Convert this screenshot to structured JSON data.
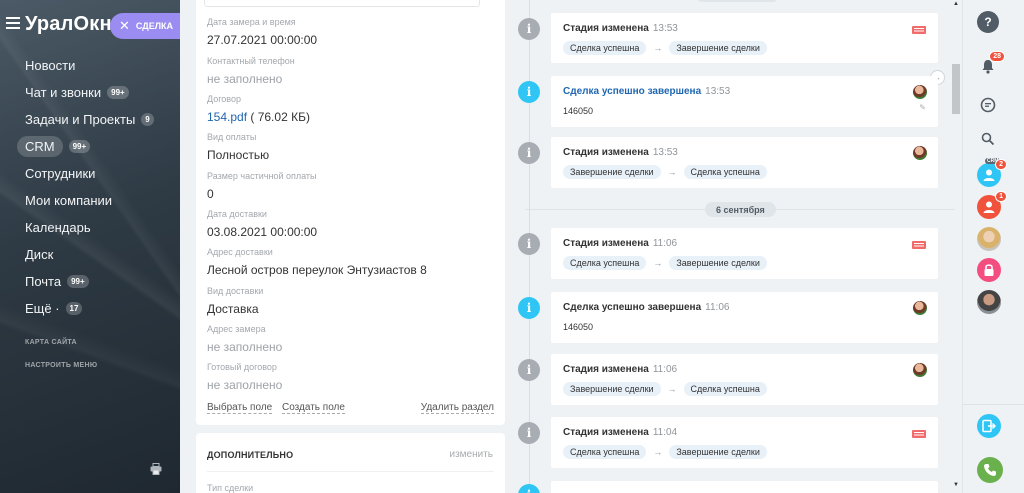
{
  "left_nav": {
    "brand": "УралОкно",
    "deal_pill": "СДЕЛКА",
    "items": [
      {
        "label": "Новости",
        "badge": ""
      },
      {
        "label": "Чат и звонки",
        "badge": "99+"
      },
      {
        "label": "Задачи и Проекты",
        "badge": "9"
      },
      {
        "label": "CRM",
        "badge": "99+"
      },
      {
        "label": "Сотрудники",
        "badge": ""
      },
      {
        "label": "Мои компании",
        "badge": ""
      },
      {
        "label": "Календарь",
        "badge": ""
      },
      {
        "label": "Диск",
        "badge": ""
      },
      {
        "label": "Почта",
        "badge": "99+"
      },
      {
        "label": "Ещё ·",
        "badge": "17"
      }
    ],
    "sitemap": "КАРТА САЙТА",
    "settings": "НАСТРОИТЬ МЕНЮ"
  },
  "details": {
    "fields": [
      {
        "label": "Дата замера и время",
        "value": "27.07.2021 00:00:00",
        "empty": false
      },
      {
        "label": "Контактный телефон",
        "value": "не заполнено",
        "empty": true
      },
      {
        "label": "Договор",
        "value": "",
        "link": "154.pdf",
        "suffix": " ( 76.02 КБ)",
        "empty": false
      },
      {
        "label": "Вид оплаты",
        "value": "Полностью",
        "empty": false
      },
      {
        "label": "Размер частичной оплаты",
        "value": "0",
        "empty": false
      },
      {
        "label": "Дата доставки",
        "value": "03.08.2021 00:00:00",
        "empty": false
      },
      {
        "label": "Адрес доставки",
        "value": "Лесной остров переулок Энтузиастов 8",
        "empty": false
      },
      {
        "label": "Вид доставки",
        "value": "Доставка",
        "empty": false
      },
      {
        "label": "Адрес замера",
        "value": "не заполнено",
        "empty": true
      },
      {
        "label": "Готовый договор",
        "value": "не заполнено",
        "empty": true
      }
    ],
    "actions": {
      "select": "Выбрать поле",
      "create": "Создать поле",
      "delete": "Удалить раздел"
    }
  },
  "extra": {
    "title": "ДОПОЛНИТЕЛЬНО",
    "change": "изменить",
    "field_label": "Тип сделки"
  },
  "timeline": {
    "date_separator": "6 сентября",
    "events": [
      {
        "type": "stage",
        "title": "Стадия изменена",
        "time": "13:53",
        "from": "Сделка успешна",
        "to": "Завершение сделки",
        "author": "crm"
      },
      {
        "type": "success",
        "title": "Сделка успешно завершена",
        "time": "13:53",
        "value": "146050",
        "author": "user"
      },
      {
        "type": "stage",
        "title": "Стадия изменена",
        "time": "13:53",
        "from": "Завершение сделки",
        "to": "Сделка успешна",
        "author": "user"
      },
      {
        "type": "stage",
        "title": "Стадия изменена",
        "time": "11:06",
        "from": "Сделка успешна",
        "to": "Завершение сделки",
        "author": "crm"
      },
      {
        "type": "success",
        "title": "Сделка успешно завершена",
        "time": "11:06",
        "value": "146050",
        "author": "user"
      },
      {
        "type": "stage",
        "title": "Стадия изменена",
        "time": "11:06",
        "from": "Завершение сделки",
        "to": "Сделка успешна",
        "author": "user"
      },
      {
        "type": "stage",
        "title": "Стадия изменена",
        "time": "11:04",
        "from": "Сделка успешна",
        "to": "Завершение сделки",
        "author": "crm"
      }
    ]
  },
  "right_bar": {
    "help": "?",
    "notifications_count": "28",
    "crm_tag": "CRM",
    "contact_count": "2",
    "user_count": "1"
  },
  "colors": {
    "accent_blue": "#2fc6f6",
    "deal_pill": "#9a8cf0",
    "danger": "#f0523c",
    "link": "#2067b0"
  }
}
